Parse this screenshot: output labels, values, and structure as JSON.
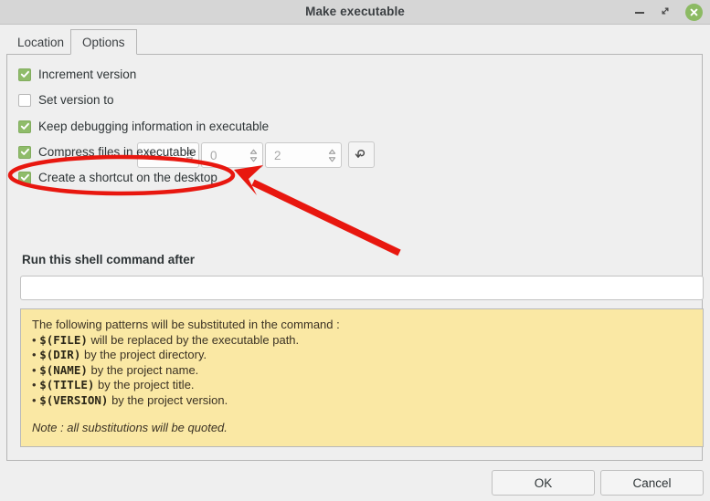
{
  "window": {
    "title": "Make executable",
    "controls": {
      "minimize": "minimize",
      "maximize": "restore",
      "close": "close"
    }
  },
  "tabs": [
    {
      "label": "Location",
      "active": false
    },
    {
      "label": "Options",
      "active": true
    }
  ],
  "options": {
    "increment_version": {
      "label": "Increment version",
      "checked": true
    },
    "set_version_to": {
      "label": "Set version to",
      "checked": false
    },
    "keep_debugging": {
      "label": "Keep debugging information in executable",
      "checked": true
    },
    "compress_files": {
      "label": "Compress files in executable",
      "checked": true
    },
    "create_shortcut": {
      "label": "Create a shortcut on the desktop",
      "checked": true
    }
  },
  "version_spinners": {
    "major": "0",
    "minor": "0",
    "patch": "2",
    "reset_tooltip": "undo"
  },
  "shell_command": {
    "label": "Run this shell command after",
    "value": "",
    "placeholder": ""
  },
  "info_box": {
    "intro": "The following patterns will be substituted in the command :",
    "patterns": [
      {
        "bullet": "•",
        "token": "$(FILE)",
        "text": "will be replaced by the executable path."
      },
      {
        "bullet": "•",
        "token": "$(DIR)",
        "text": "by the project directory."
      },
      {
        "bullet": "•",
        "token": "$(NAME)",
        "text": "by the project name."
      },
      {
        "bullet": "•",
        "token": "$(TITLE)",
        "text": "by the project title."
      },
      {
        "bullet": "•",
        "token": "$(VERSION)",
        "text": "by the project version."
      }
    ],
    "note": "Note : all substitutions will be quoted."
  },
  "footer": {
    "ok_label": "OK",
    "cancel_label": "Cancel"
  },
  "annotation": {
    "highlight_target": "Create a shortcut on the desktop",
    "color": "#e8170f",
    "shapes": [
      "ellipse",
      "arrow"
    ]
  },
  "colors": {
    "titlebar": "#d6d6d6",
    "window_bg": "#efefef",
    "checkbox_on": "#8fbc6a",
    "info_bg": "#fae8a4",
    "close_button": "#8cba63",
    "annotation_red": "#e8170f"
  }
}
